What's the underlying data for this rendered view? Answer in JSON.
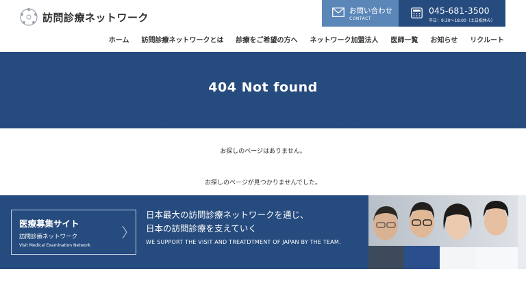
{
  "header": {
    "logo_text": "訪問診療ネットワーク",
    "contact": {
      "label": "お問い合わせ",
      "sub": "CONTACT"
    },
    "tel": {
      "number": "045-681-3500",
      "hours": "平日：9:30〜18:00（土日祝休み）"
    }
  },
  "nav": {
    "items": [
      {
        "label": "ホーム"
      },
      {
        "label": "訪問診療ネットワークとは"
      },
      {
        "label": "診療をご希望の方へ"
      },
      {
        "label": "ネットワーク加盟法人"
      },
      {
        "label": "医師一覧"
      },
      {
        "label": "お知らせ"
      },
      {
        "label": "リクルート"
      }
    ]
  },
  "hero": {
    "title": "404 Not found"
  },
  "messages": {
    "line1": "お探しのページはありません。",
    "line2": "お探しのページが見つかりませんでした。"
  },
  "banner": {
    "recruit_title": "医療募集サイト",
    "recruit_sub": "訪問診療ネットワーク",
    "recruit_en": "Visit Medical Examination Network",
    "headline_line1": "日本最大の訪問診療ネットワークを通じ、",
    "headline_line2": "日本の訪問診療を支えていく",
    "english": "WE SUPPORT THE VISIT AND TREATDTMENT OF JAPAN BY THE TEAM."
  },
  "icons": {
    "logo": "circle-dots-logo-icon",
    "contact": "mail-icon",
    "tel": "phone-icon",
    "recruit_arrow": "chevron-right-icon"
  },
  "colors": {
    "primary": "#264b7e",
    "contact_bg": "#5b86b8"
  }
}
